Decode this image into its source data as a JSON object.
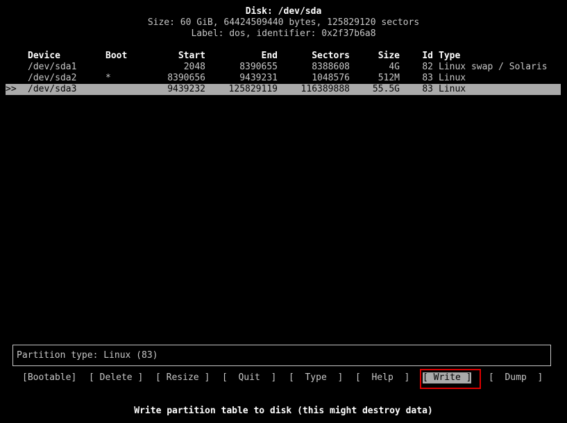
{
  "header": {
    "title": "Disk: /dev/sda",
    "size_line": "Size: 60 GiB, 64424509440 bytes, 125829120 sectors",
    "label_line": "Label: dos, identifier: 0x2f37b6a8"
  },
  "table": {
    "columns": {
      "device": "Device",
      "boot": "Boot",
      "start": "Start",
      "end": "End",
      "sectors": "Sectors",
      "size": "Size",
      "id": "Id",
      "type": "Type"
    },
    "rows": [
      {
        "marker": "",
        "device": "/dev/sda1",
        "boot": "",
        "start": "2048",
        "end": "8390655",
        "sectors": "8388608",
        "size": "4G",
        "id": "82",
        "type": "Linux swap / Solaris"
      },
      {
        "marker": "",
        "device": "/dev/sda2",
        "boot": "*",
        "start": "8390656",
        "end": "9439231",
        "sectors": "1048576",
        "size": "512M",
        "id": "83",
        "type": "Linux"
      },
      {
        "marker": ">>",
        "device": "/dev/sda3",
        "boot": "",
        "start": "9439232",
        "end": "125829119",
        "sectors": "116389888",
        "size": "55.5G",
        "id": "83",
        "type": "Linux"
      }
    ]
  },
  "info": {
    "partition_type": "Partition type: Linux (83)"
  },
  "menu": {
    "bootable": "[Bootable]",
    "delete": "[ Delete ]",
    "resize": "[ Resize ]",
    "quit": "[  Quit  ]",
    "type": "[  Type  ]",
    "help": "[  Help  ]",
    "write": "[ Write ]",
    "dump": "[  Dump  ]"
  },
  "hint": "Write partition table to disk (this might destroy data)",
  "colors": {
    "background": "#000000",
    "text": "#c8c8c8",
    "selection": "#aaaaaa",
    "focus_ring": "#e00000"
  }
}
